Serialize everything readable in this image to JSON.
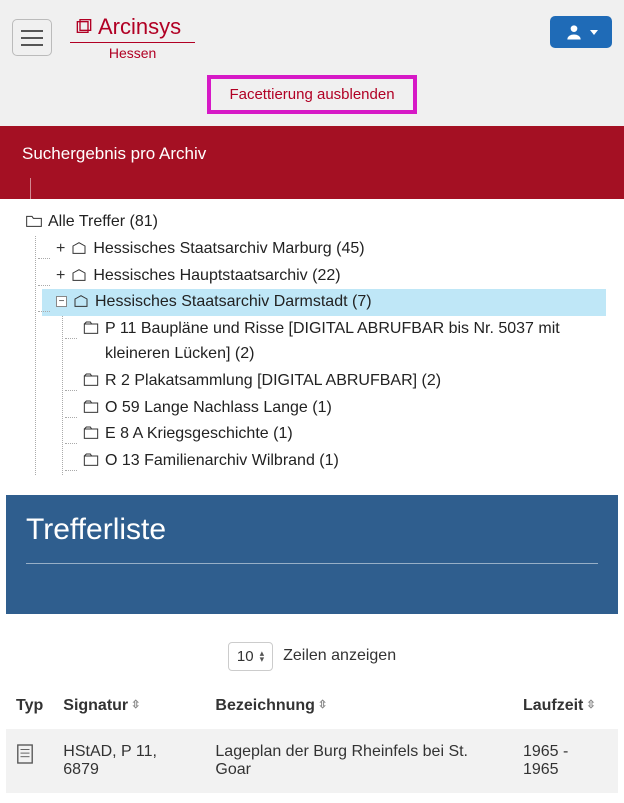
{
  "header": {
    "brand": "Arcinsys",
    "region": "Hessen"
  },
  "facet": {
    "toggle_label": "Facettierung ausblenden"
  },
  "red_panel": {
    "title": "Suchergebnis pro Archiv"
  },
  "tree": {
    "root": {
      "label": "Alle Treffer",
      "count": "81"
    },
    "nodes": [
      {
        "label": "Hessisches Staatsarchiv Marburg",
        "count": "45",
        "expandable": true
      },
      {
        "label": "Hessisches Hauptstaatsarchiv",
        "count": "22",
        "expandable": true
      },
      {
        "label": "Hessisches Staatsarchiv Darmstadt",
        "count": "7",
        "expandable": true,
        "selected": true,
        "children": [
          {
            "label": "P 11 Baupläne und Risse [DIGITAL ABRUFBAR bis Nr. 5037 mit kleineren Lücken]",
            "count": "2"
          },
          {
            "label": "R 2 Plakatsammlung [DIGITAL ABRUFBAR]",
            "count": "2"
          },
          {
            "label": "O 59 Lange Nachlass Lange",
            "count": "1"
          },
          {
            "label": "E 8 A Kriegsgeschichte",
            "count": "1"
          },
          {
            "label": "O 13 Familienarchiv Wilbrand",
            "count": "1"
          }
        ]
      }
    ]
  },
  "results": {
    "title": "Trefferliste",
    "page_size": "10",
    "rows_label": "Zeilen anzeigen",
    "columns": {
      "type": "Typ",
      "signature": "Signatur",
      "title": "Bezeichnung",
      "runtime": "Laufzeit"
    },
    "rows": [
      {
        "signature": "HStAD, P 11, 6879",
        "title": "Lageplan der Burg Rheinfels bei St. Goar",
        "runtime": "1965 - 1965"
      }
    ]
  }
}
